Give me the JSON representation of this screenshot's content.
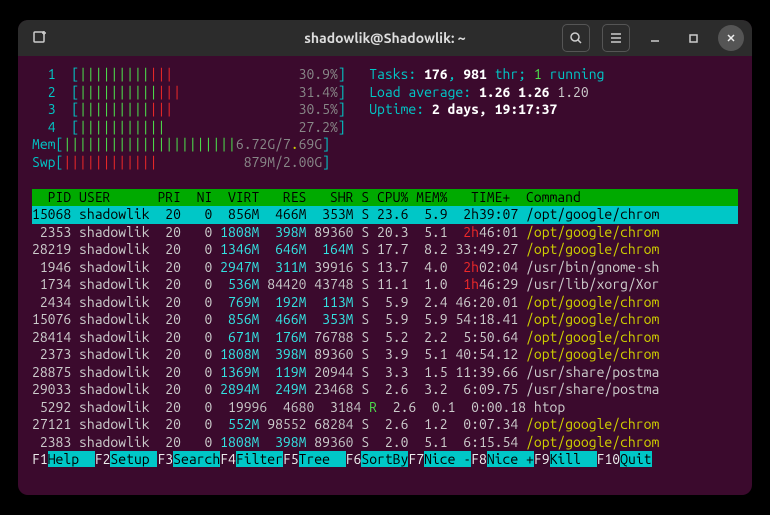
{
  "window": {
    "title": "shadowlik@Shadowlik: ~"
  },
  "cpu_meters": [
    {
      "num": "1",
      "bar": "||||||||||||",
      "fill_g": 9,
      "fill_r": 3,
      "pct": "30.9%"
    },
    {
      "num": "2",
      "bar": "|||||||||||||",
      "fill_g": 10,
      "fill_r": 3,
      "pct": "31.4%"
    },
    {
      "num": "3",
      "bar": "||||||||||||",
      "fill_g": 9,
      "fill_r": 3,
      "pct": "30.5%"
    },
    {
      "num": "4",
      "bar": "|||||||||||",
      "fill_g": 11,
      "fill_r": 0,
      "pct": "27.2%"
    }
  ],
  "mem": {
    "label": "Mem",
    "bars_g": 22,
    "bars_y": 0,
    "text": "6.72G/7.69G"
  },
  "swp": {
    "label": "Swp",
    "bars_r": 12,
    "text": "879M/2.00G"
  },
  "info": {
    "tasks_label": "Tasks:",
    "tasks_count": "176",
    "thr": "981",
    "thr_label": "thr;",
    "running": "1",
    "running_label": "running",
    "load_label": "Load average:",
    "load1": "1.26",
    "load2": "1.26",
    "load3": "1.20",
    "uptime_label": "Uptime:",
    "uptime": "2 days, 19:17:37"
  },
  "columns": "  PID USER      PRI  NI  VIRT   RES   SHR S CPU% MEM%   TIME+  Command",
  "processes": [
    {
      "pid": "15068",
      "user": "shadowlik",
      "pri": "20",
      "ni": "0",
      "virt": "856M",
      "res": "466M",
      "shr": "353M",
      "s": "S",
      "cpu": "23.6",
      "mem": "5.9",
      "time": "2h39:07",
      "time_red": false,
      "cmd": "/opt/google/chrom",
      "sel": true
    },
    {
      "pid": "2353",
      "user": "shadowlik",
      "pri": "20",
      "ni": "0",
      "virt": "1808M",
      "res": "398M",
      "shr_a": "89",
      "shr_b": "360",
      "s": "S",
      "cpu": "20.3",
      "mem": "5.1",
      "time_r": "2h",
      "time_rest": "46:01",
      "cmd": "/opt/google/chrom",
      "cmdyl": true
    },
    {
      "pid": "28219",
      "user": "shadowlik",
      "pri": "20",
      "ni": "0",
      "virt": "1346M",
      "res": "646M",
      "shr": "164M",
      "s": "S",
      "cpu": "17.7",
      "mem": "8.2",
      "time": "33:49.27",
      "cmd": "/opt/google/chrom",
      "cmdyl": true
    },
    {
      "pid": "1946",
      "user": "shadowlik",
      "pri": "20",
      "ni": "0",
      "virt": "2947M",
      "res": "311M",
      "shr_a": "39",
      "shr_b": "916",
      "s": "S",
      "cpu": "13.7",
      "mem": "4.0",
      "time_r": "2h",
      "time_rest": "02:04",
      "cmd": "/usr/bin/gnome-sh"
    },
    {
      "pid": "1734",
      "user": "shadowlik",
      "pri": "20",
      "ni": "0",
      "virt": "536M",
      "res_a": "84",
      "res_b": "420",
      "shr_a": "43",
      "shr_b": "748",
      "s": "S",
      "cpu": "11.1",
      "mem": "1.0",
      "time_r": "1h",
      "time_rest": "46:29",
      "cmd": "/usr/lib/xorg/Xor"
    },
    {
      "pid": "2434",
      "user": "shadowlik",
      "pri": "20",
      "ni": "0",
      "virt": "769M",
      "res": "192M",
      "shr": "113M",
      "s": "S",
      "cpu": "5.9",
      "mem": "2.4",
      "time": "46:20.01",
      "cmd": "/opt/google/chrom",
      "cmdyl": true
    },
    {
      "pid": "15076",
      "user": "shadowlik",
      "pri": "20",
      "ni": "0",
      "virt": "856M",
      "res": "466M",
      "shr": "353M",
      "s": "S",
      "cpu": "5.9",
      "mem": "5.9",
      "time": "54:18.41",
      "cmd": "/opt/google/chrom",
      "cmdyl": true
    },
    {
      "pid": "28414",
      "user": "shadowlik",
      "pri": "20",
      "ni": "0",
      "virt": "671M",
      "res": "176M",
      "shr_a": "76",
      "shr_b": "788",
      "s": "S",
      "cpu": "5.2",
      "mem": "2.2",
      "time": "5:50.64",
      "cmd": "/opt/google/chrom",
      "cmdyl": true
    },
    {
      "pid": "2373",
      "user": "shadowlik",
      "pri": "20",
      "ni": "0",
      "virt": "1808M",
      "res": "398M",
      "shr_a": "89",
      "shr_b": "360",
      "s": "S",
      "cpu": "3.9",
      "mem": "5.1",
      "time": "40:54.12",
      "cmd": "/opt/google/chrom",
      "cmdyl": true
    },
    {
      "pid": "28875",
      "user": "shadowlik",
      "pri": "20",
      "ni": "0",
      "virt": "1369M",
      "res": "119M",
      "shr_a": "20",
      "shr_b": "944",
      "s": "S",
      "cpu": "3.3",
      "mem": "1.5",
      "time": "11:39.66",
      "cmd": "/usr/share/postma"
    },
    {
      "pid": "29033",
      "user": "shadowlik",
      "pri": "20",
      "ni": "0",
      "virt": "2894M",
      "res": "249M",
      "shr_a": "23",
      "shr_b": "468",
      "s": "S",
      "cpu": "2.6",
      "mem": "3.2",
      "time": "6:09.75",
      "cmd": "/usr/share/postma"
    },
    {
      "pid": "5292",
      "user": "shadowlik",
      "pri": "20",
      "ni": "0",
      "virt_a": "19",
      "virt_b": "996",
      "res_a": "4",
      "res_b": "680",
      "shr_a": "3",
      "shr_b": "184",
      "s": "R",
      "s_green": true,
      "cpu": "2.6",
      "mem": "0.1",
      "time": "0:00.18",
      "cmd": "htop"
    },
    {
      "pid": "27121",
      "user": "shadowlik",
      "pri": "20",
      "ni": "0",
      "virt": "552M",
      "res_a": "98",
      "res_b": "552",
      "shr_a": "68",
      "shr_b": "284",
      "s": "S",
      "cpu": "2.6",
      "mem": "1.2",
      "time": "0:07.34",
      "cmd": "/opt/google/chrom",
      "cmdyl": true
    },
    {
      "pid": "2383",
      "user": "shadowlik",
      "pri": "20",
      "ni": "0",
      "virt": "1808M",
      "res": "398M",
      "shr_a": "89",
      "shr_b": "360",
      "s": "S",
      "cpu": "2.0",
      "mem": "5.1",
      "time": "6:15.54",
      "cmd": "/opt/google/chrom",
      "cmdyl": true
    }
  ],
  "footer": [
    {
      "key": "F1",
      "label": "Help  "
    },
    {
      "key": "F2",
      "label": "Setup "
    },
    {
      "key": "F3",
      "label": "Search"
    },
    {
      "key": "F4",
      "label": "Filter"
    },
    {
      "key": "F5",
      "label": "Tree  "
    },
    {
      "key": "F6",
      "label": "SortBy"
    },
    {
      "key": "F7",
      "label": "Nice -"
    },
    {
      "key": "F8",
      "label": "Nice +"
    },
    {
      "key": "F9",
      "label": "Kill  "
    },
    {
      "key": "F10",
      "label": "Quit"
    }
  ]
}
